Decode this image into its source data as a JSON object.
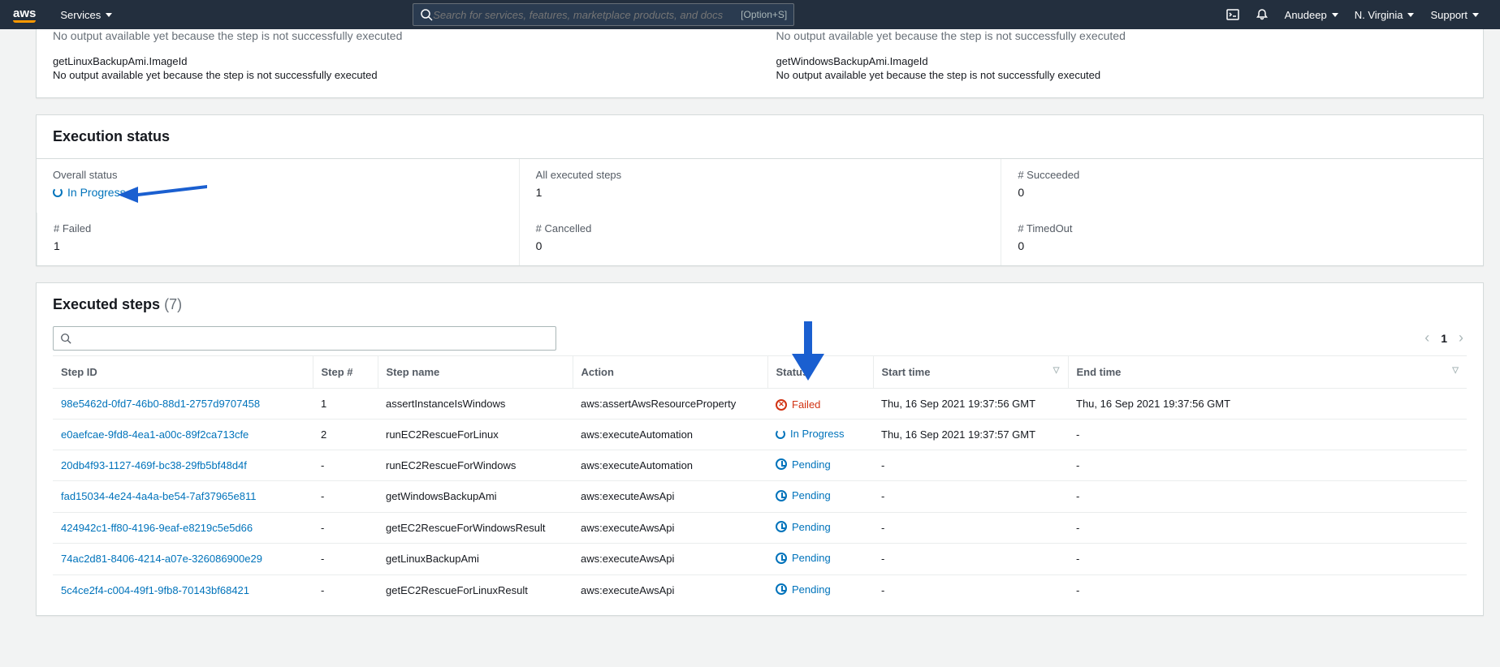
{
  "topnav": {
    "services": "Services",
    "search_placeholder": "Search for services, features, marketplace products, and docs",
    "search_shortcut": "[Option+S]",
    "user": "Anudeep",
    "region": "N. Virginia",
    "support": "Support"
  },
  "outputs": {
    "cutoff_left": "No output available yet because the step is not successfully executed",
    "cutoff_right": "No output available yet because the step is not successfully executed",
    "left": {
      "title": "getLinuxBackupAmi.ImageId",
      "msg": "No output available yet because the step is not successfully executed"
    },
    "right": {
      "title": "getWindowsBackupAmi.ImageId",
      "msg": "No output available yet because the step is not successfully executed"
    }
  },
  "exec_status": {
    "header": "Execution status",
    "overall_label": "Overall status",
    "overall_value": "In Progress",
    "executed_label": "All executed steps",
    "executed_value": "1",
    "succeeded_label": "# Succeeded",
    "succeeded_value": "0",
    "failed_label": "# Failed",
    "failed_value": "1",
    "cancelled_label": "# Cancelled",
    "cancelled_value": "0",
    "timedout_label": "# TimedOut",
    "timedout_value": "0"
  },
  "steps": {
    "header": "Executed steps",
    "count": "(7)",
    "page": "1",
    "columns": {
      "step_id": "Step ID",
      "step_num": "Step #",
      "step_name": "Step name",
      "action": "Action",
      "status": "Status",
      "start": "Start time",
      "end": "End time"
    },
    "rows": [
      {
        "id": "98e5462d-0fd7-46b0-88d1-2757d9707458",
        "num": "1",
        "name": "assertInstanceIsWindows",
        "action": "aws:assertAwsResourceProperty",
        "status": "Failed",
        "status_type": "failed",
        "start": "Thu, 16 Sep 2021 19:37:56 GMT",
        "end": "Thu, 16 Sep 2021 19:37:56 GMT"
      },
      {
        "id": "e0aefcae-9fd8-4ea1-a00c-89f2ca713cfe",
        "num": "2",
        "name": "runEC2RescueForLinux",
        "action": "aws:executeAutomation",
        "status": "In Progress",
        "status_type": "inprogress",
        "start": "Thu, 16 Sep 2021 19:37:57 GMT",
        "end": "-"
      },
      {
        "id": "20db4f93-1127-469f-bc38-29fb5bf48d4f",
        "num": "-",
        "name": "runEC2RescueForWindows",
        "action": "aws:executeAutomation",
        "status": "Pending",
        "status_type": "pending",
        "start": "-",
        "end": "-"
      },
      {
        "id": "fad15034-4e24-4a4a-be54-7af37965e811",
        "num": "-",
        "name": "getWindowsBackupAmi",
        "action": "aws:executeAwsApi",
        "status": "Pending",
        "status_type": "pending",
        "start": "-",
        "end": "-"
      },
      {
        "id": "424942c1-ff80-4196-9eaf-e8219c5e5d66",
        "num": "-",
        "name": "getEC2RescueForWindowsResult",
        "action": "aws:executeAwsApi",
        "status": "Pending",
        "status_type": "pending",
        "start": "-",
        "end": "-"
      },
      {
        "id": "74ac2d81-8406-4214-a07e-326086900e29",
        "num": "-",
        "name": "getLinuxBackupAmi",
        "action": "aws:executeAwsApi",
        "status": "Pending",
        "status_type": "pending",
        "start": "-",
        "end": "-"
      },
      {
        "id": "5c4ce2f4-c004-49f1-9fb8-70143bf68421",
        "num": "-",
        "name": "getEC2RescueForLinuxResult",
        "action": "aws:executeAwsApi",
        "status": "Pending",
        "status_type": "pending",
        "start": "-",
        "end": "-"
      }
    ]
  }
}
